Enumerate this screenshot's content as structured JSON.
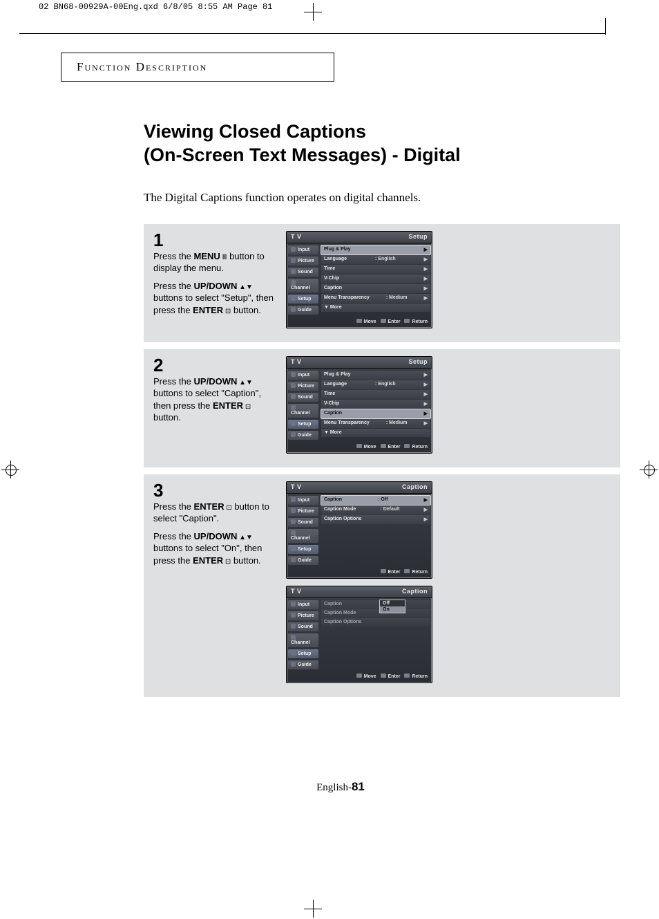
{
  "print_header": "02 BN68-00929A-00Eng.qxd  6/8/05 8:55 AM  Page 81",
  "section_head": "Function Description",
  "title_line1": "Viewing Closed Captions",
  "title_line2": "(On-Screen Text Messages) - Digital",
  "intro": "The Digital Captions function operates on digital channels.",
  "osd_nav": [
    "Input",
    "Picture",
    "Sound",
    "Channel",
    "Setup",
    "Guide"
  ],
  "steps": {
    "s1": {
      "num": "1",
      "p1a": "Press the ",
      "p1b": "MENU",
      "p1c": " button to display the menu.",
      "p2a": "Press the ",
      "p2b": "UP/DOWN",
      "p2c": " buttons to select \"Setup\", then press the ",
      "p2d": "ENTER",
      "p2e": " button.",
      "shot": {
        "brand": "T V",
        "title": "Setup",
        "highlight": 0,
        "items": [
          {
            "label": "Plug & Play",
            "value": "",
            "arrow": true
          },
          {
            "label": "Language",
            "value": ": English",
            "arrow": true
          },
          {
            "label": "Time",
            "value": "",
            "arrow": true
          },
          {
            "label": "V-Chip",
            "value": "",
            "arrow": true
          },
          {
            "label": "Caption",
            "value": "",
            "arrow": true
          },
          {
            "label": "Menu Transparency",
            "value": ": Medium",
            "arrow": true
          },
          {
            "label": "▼  More",
            "value": "",
            "arrow": false
          }
        ],
        "footer": [
          "Move",
          "Enter",
          "Return"
        ]
      }
    },
    "s2": {
      "num": "2",
      "p1a": "Press the ",
      "p1b": "UP/DOWN",
      "p1c": " buttons  to select \"Caption\", then press the ",
      "p1d": "ENTER",
      "p1e": " button.",
      "shot": {
        "brand": "T V",
        "title": "Setup",
        "highlight": 4,
        "items": [
          {
            "label": "Plug & Play",
            "value": "",
            "arrow": true
          },
          {
            "label": "Language",
            "value": ": English",
            "arrow": true
          },
          {
            "label": "Time",
            "value": "",
            "arrow": true
          },
          {
            "label": "V-Chip",
            "value": "",
            "arrow": true
          },
          {
            "label": "Caption",
            "value": "",
            "arrow": true
          },
          {
            "label": "Menu Transparency",
            "value": ": Medium",
            "arrow": true
          },
          {
            "label": "▼  More",
            "value": "",
            "arrow": false
          }
        ],
        "footer": [
          "Move",
          "Enter",
          "Return"
        ]
      }
    },
    "s3": {
      "num": "3",
      "p1a": "Press the ",
      "p1b": "ENTER",
      "p1c": "  button to select \"Caption\".",
      "p2a": "Press the ",
      "p2b": "UP/DOWN",
      "p2c": " buttons to select  \"On\", then press the ",
      "p2d": "ENTER",
      "p2e": "  button.",
      "shotA": {
        "brand": "T V",
        "title": "Caption",
        "highlight": 0,
        "items": [
          {
            "label": "Caption",
            "value": ": Off",
            "arrow": true
          },
          {
            "label": "Caption Mode",
            "value": ": Default",
            "arrow": true
          },
          {
            "label": "Caption Options",
            "value": "",
            "arrow": true
          }
        ],
        "footer": [
          "Enter",
          "Return"
        ]
      },
      "shotB": {
        "brand": "T V",
        "title": "Caption",
        "items": [
          {
            "label": "Caption",
            "value": "",
            "arrow": false
          },
          {
            "label": "Caption Mode",
            "value": "",
            "arrow": false
          },
          {
            "label": "Caption Options",
            "value": "",
            "arrow": false
          }
        ],
        "popup": {
          "options": [
            "Off",
            "On"
          ],
          "selected": 1
        },
        "footer": [
          "Move",
          "Enter",
          "Return"
        ]
      }
    }
  },
  "page_footer_prefix": "English-",
  "page_footer_num": "81"
}
